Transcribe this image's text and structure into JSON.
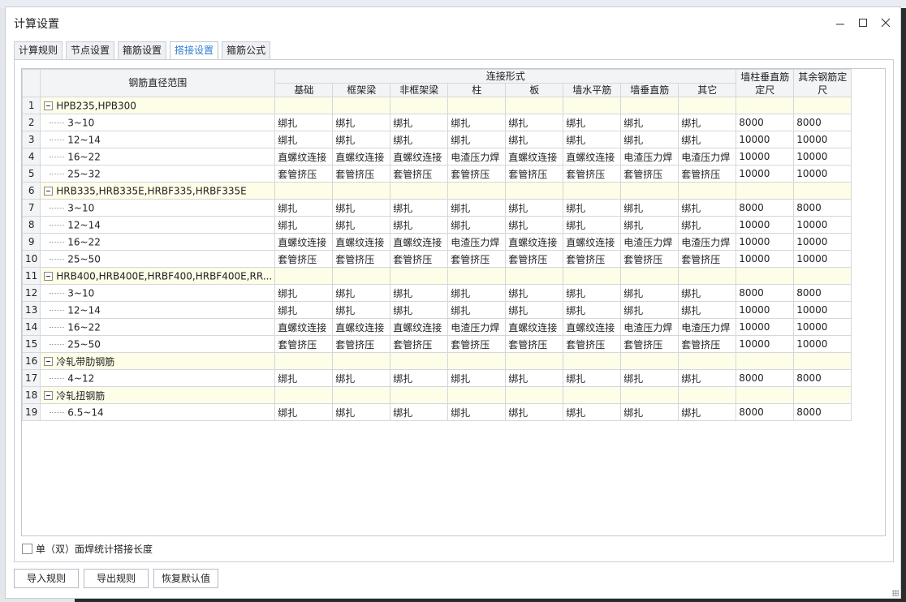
{
  "window": {
    "title": "计算设置"
  },
  "tabs": [
    {
      "label": "计算规则",
      "active": false
    },
    {
      "label": "节点设置",
      "active": false
    },
    {
      "label": "箍筋设置",
      "active": false
    },
    {
      "label": "搭接设置",
      "active": true
    },
    {
      "label": "箍筋公式",
      "active": false
    }
  ],
  "table": {
    "header_range": "钢筋直径范围",
    "header_group": "连接形式",
    "columns": [
      "基础",
      "框架梁",
      "非框架梁",
      "柱",
      "板",
      "墙水平筋",
      "墙垂直筋",
      "其它"
    ],
    "header_wall": "墙柱垂直筋定尺",
    "header_other": "其余钢筋定尺",
    "rows": [
      {
        "num": "1",
        "group": true,
        "label": "HPB235,HPB300"
      },
      {
        "num": "2",
        "label": "3~10",
        "cells": [
          "绑扎",
          "绑扎",
          "绑扎",
          "绑扎",
          "绑扎",
          "绑扎",
          "绑扎",
          "绑扎",
          "8000",
          "8000"
        ]
      },
      {
        "num": "3",
        "label": "12~14",
        "cells": [
          "绑扎",
          "绑扎",
          "绑扎",
          "绑扎",
          "绑扎",
          "绑扎",
          "绑扎",
          "绑扎",
          "10000",
          "10000"
        ]
      },
      {
        "num": "4",
        "label": "16~22",
        "cells": [
          "直螺纹连接",
          "直螺纹连接",
          "直螺纹连接",
          "电渣压力焊",
          "直螺纹连接",
          "直螺纹连接",
          "电渣压力焊",
          "电渣压力焊",
          "10000",
          "10000"
        ]
      },
      {
        "num": "5",
        "label": "25~32",
        "cells": [
          "套管挤压",
          "套管挤压",
          "套管挤压",
          "套管挤压",
          "套管挤压",
          "套管挤压",
          "套管挤压",
          "套管挤压",
          "10000",
          "10000"
        ]
      },
      {
        "num": "6",
        "group": true,
        "label": "HRB335,HRB335E,HRBF335,HRBF335E"
      },
      {
        "num": "7",
        "label": "3~10",
        "cells": [
          "绑扎",
          "绑扎",
          "绑扎",
          "绑扎",
          "绑扎",
          "绑扎",
          "绑扎",
          "绑扎",
          "8000",
          "8000"
        ]
      },
      {
        "num": "8",
        "label": "12~14",
        "cells": [
          "绑扎",
          "绑扎",
          "绑扎",
          "绑扎",
          "绑扎",
          "绑扎",
          "绑扎",
          "绑扎",
          "10000",
          "10000"
        ]
      },
      {
        "num": "9",
        "label": "16~22",
        "cells": [
          "直螺纹连接",
          "直螺纹连接",
          "直螺纹连接",
          "电渣压力焊",
          "直螺纹连接",
          "直螺纹连接",
          "电渣压力焊",
          "电渣压力焊",
          "10000",
          "10000"
        ]
      },
      {
        "num": "10",
        "label": "25~50",
        "cells": [
          "套管挤压",
          "套管挤压",
          "套管挤压",
          "套管挤压",
          "套管挤压",
          "套管挤压",
          "套管挤压",
          "套管挤压",
          "10000",
          "10000"
        ]
      },
      {
        "num": "11",
        "group": true,
        "label": "HRB400,HRB400E,HRBF400,HRBF400E,RR..."
      },
      {
        "num": "12",
        "label": "3~10",
        "cells": [
          "绑扎",
          "绑扎",
          "绑扎",
          "绑扎",
          "绑扎",
          "绑扎",
          "绑扎",
          "绑扎",
          "8000",
          "8000"
        ]
      },
      {
        "num": "13",
        "label": "12~14",
        "cells": [
          "绑扎",
          "绑扎",
          "绑扎",
          "绑扎",
          "绑扎",
          "绑扎",
          "绑扎",
          "绑扎",
          "10000",
          "10000"
        ]
      },
      {
        "num": "14",
        "label": "16~22",
        "cells": [
          "直螺纹连接",
          "直螺纹连接",
          "直螺纹连接",
          "电渣压力焊",
          "直螺纹连接",
          "直螺纹连接",
          "电渣压力焊",
          "电渣压力焊",
          "10000",
          "10000"
        ]
      },
      {
        "num": "15",
        "label": "25~50",
        "cells": [
          "套管挤压",
          "套管挤压",
          "套管挤压",
          "套管挤压",
          "套管挤压",
          "套管挤压",
          "套管挤压",
          "套管挤压",
          "10000",
          "10000"
        ]
      },
      {
        "num": "16",
        "group": true,
        "label": "冷轧带肋钢筋"
      },
      {
        "num": "17",
        "label": "4~12",
        "cells": [
          "绑扎",
          "绑扎",
          "绑扎",
          "绑扎",
          "绑扎",
          "绑扎",
          "绑扎",
          "绑扎",
          "8000",
          "8000"
        ]
      },
      {
        "num": "18",
        "group": true,
        "label": "冷轧扭钢筋"
      },
      {
        "num": "19",
        "label": "6.5~14",
        "cells": [
          "绑扎",
          "绑扎",
          "绑扎",
          "绑扎",
          "绑扎",
          "绑扎",
          "绑扎",
          "绑扎",
          "8000",
          "8000"
        ]
      }
    ]
  },
  "options": {
    "weld_label": "单（双）面焊统计搭接长度"
  },
  "buttons": {
    "import": "导入规则",
    "export": "导出规则",
    "restore": "恢复默认值"
  }
}
